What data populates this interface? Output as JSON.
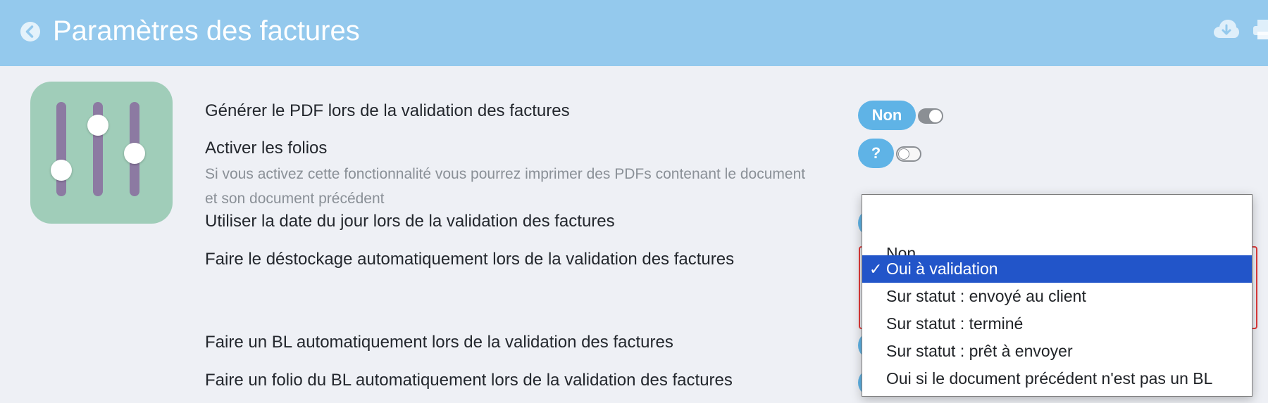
{
  "header": {
    "title": "Paramètres des factures",
    "icons": [
      "back-icon",
      "cloud-download-icon",
      "print-icon"
    ],
    "color": "#94c9ed"
  },
  "app_icon": {
    "name": "sliders-icon",
    "background": "#a0cdb9"
  },
  "settings": [
    {
      "label": "Générer le PDF lors de la validation des factures",
      "pill": "Non",
      "toggle_on": true
    },
    {
      "label": "Activer les folios",
      "description": "Si vous activez cette fonctionnalité vous pourrez imprimer des PDFs contenant le document et son document précédent",
      "pill": "?",
      "toggle_on": false
    },
    {
      "label": "Utiliser la date du jour lors de la validation des factures"
    },
    {
      "label": "Faire le déstockage automatiquement lors de la validation des factures"
    },
    {
      "label": "Faire un BL automatiquement lors de la validation des factures"
    },
    {
      "label": "Faire un folio du BL automatiquement lors de la validation des factures"
    }
  ],
  "dropdown": {
    "selected": "Oui à validation",
    "check": "✓",
    "options": [
      "",
      "Non",
      "Oui à validation",
      "Sur statut : envoyé au client",
      "Sur statut : terminé",
      "Sur statut : prêt à envoyer",
      "Oui si le document précédent n'est pas un BL"
    ]
  },
  "colors": {
    "accent": "#5fb3e6",
    "selection": "#2255c9",
    "invalid_outline": "#e03a3a"
  }
}
